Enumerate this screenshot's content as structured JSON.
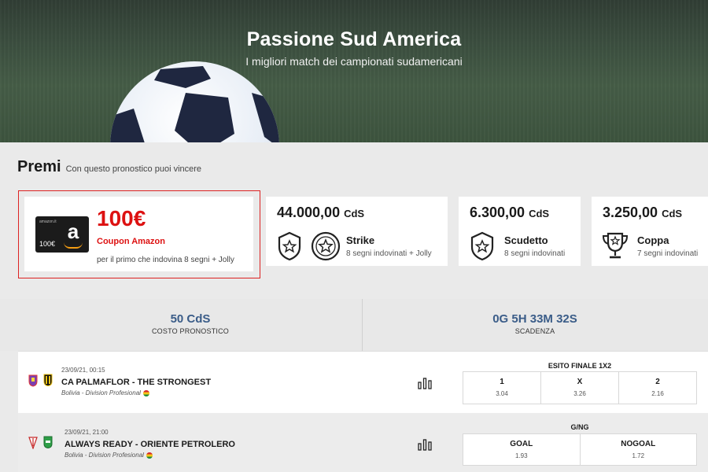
{
  "hero": {
    "title": "Passione Sud America",
    "subtitle": "I migliori match dei campionati sudamericani"
  },
  "premi": {
    "title": "Premi",
    "subtitle": "Con questo pronostico puoi vincere",
    "amazon": {
      "amount": "100€",
      "name": "Coupon Amazon",
      "description": "per il primo che indovina 8 segni + Jolly",
      "logo_value": "100€",
      "logo_top": "amazon.it"
    },
    "prizes": [
      {
        "amount": "44.000,00",
        "unit": "CdS",
        "name": "Strike",
        "description": "8 segni indovinati + Jolly",
        "icons": [
          "shield-star-icon",
          "ball-star-icon"
        ]
      },
      {
        "amount": "6.300,00",
        "unit": "CdS",
        "name": "Scudetto",
        "description": "8 segni indovinati",
        "icons": [
          "shield-star-icon"
        ]
      },
      {
        "amount": "3.250,00",
        "unit": "CdS",
        "name": "Coppa",
        "description": "7 segni indovinati",
        "icons": [
          "trophy-icon"
        ]
      }
    ]
  },
  "summary": {
    "cost_value": "50 CdS",
    "cost_label": "COSTO PRONOSTICO",
    "deadline_value": "0G 5H 33M 32S",
    "deadline_label": "SCADENZA"
  },
  "matches": [
    {
      "datetime": "23/09/21, 00:15",
      "teams": "CA PALMAFLOR - THE STRONGEST",
      "league": "Bolivia - Division Profesional",
      "bet_title": "ESITO FINALE 1X2",
      "options": [
        {
          "label": "1",
          "odd": "3.04"
        },
        {
          "label": "X",
          "odd": "3.26"
        },
        {
          "label": "2",
          "odd": "2.16"
        }
      ]
    },
    {
      "datetime": "23/09/21, 21:00",
      "teams": "ALWAYS READY - ORIENTE PETROLERO",
      "league": "Bolivia - Division Profesional",
      "bet_title": "G/NG",
      "options": [
        {
          "label": "GOAL",
          "odd": "1.93"
        },
        {
          "label": "NOGOAL",
          "odd": "1.72"
        }
      ]
    }
  ],
  "colors": {
    "accent_red": "#dd1111",
    "accent_blue": "#3a5c88"
  }
}
